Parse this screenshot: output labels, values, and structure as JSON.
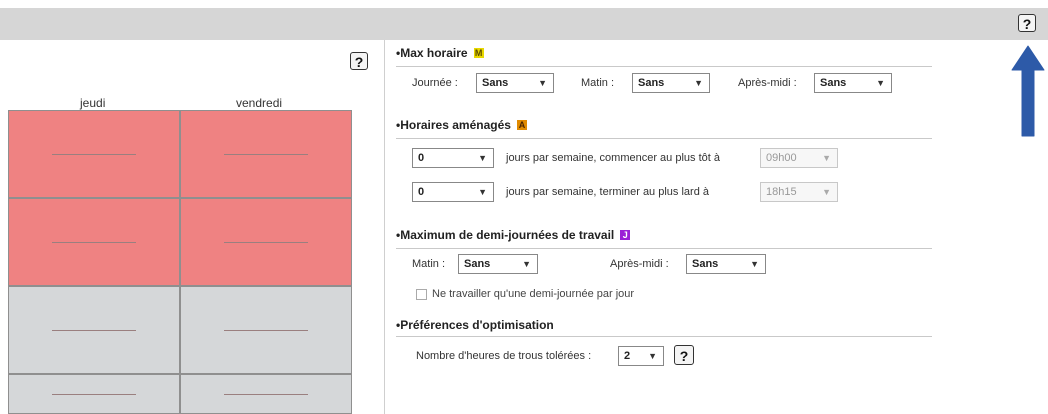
{
  "top_help": "?",
  "panel_help": "?",
  "days": [
    "jeudi",
    "vendredi"
  ],
  "grid_rows": [
    {
      "jeudi": "red",
      "vendredi": "red"
    },
    {
      "jeudi": "red",
      "vendredi": "red"
    },
    {
      "jeudi": "grey",
      "vendredi": "grey"
    },
    {
      "jeudi": "grey",
      "vendredi": "grey"
    }
  ],
  "max_horaire": {
    "title": "Max horaire",
    "badge": "M",
    "badge_color": "#e8d800",
    "journee_label": "Journée :",
    "journee_value": "Sans",
    "matin_label": "Matin :",
    "matin_value": "Sans",
    "apres_midi_label": "Après-midi :",
    "apres_midi_value": "Sans"
  },
  "horaires_amenages": {
    "title": "Horaires aménagés",
    "badge": "A",
    "badge_color": "#e08a00",
    "row1_count": "0",
    "row1_text": "jours par semaine, commencer au plus tôt à",
    "row1_time": "09h00",
    "row2_count": "0",
    "row2_text": "jours par semaine, terminer au plus lard à",
    "row2_time": "18h15"
  },
  "demi_journees": {
    "title": "Maximum de demi-journées de travail",
    "badge": "J",
    "badge_color": "#9b1fd6",
    "matin_label": "Matin :",
    "matin_value": "Sans",
    "apres_midi_label": "Après-midi :",
    "apres_midi_value": "Sans",
    "checkbox_label": "Ne travailler qu'une demi-journée par jour"
  },
  "optimisation": {
    "title": "Préférences d'optimisation",
    "trous_label": "Nombre d'heures de trous tolérées :",
    "trous_value": "2"
  }
}
